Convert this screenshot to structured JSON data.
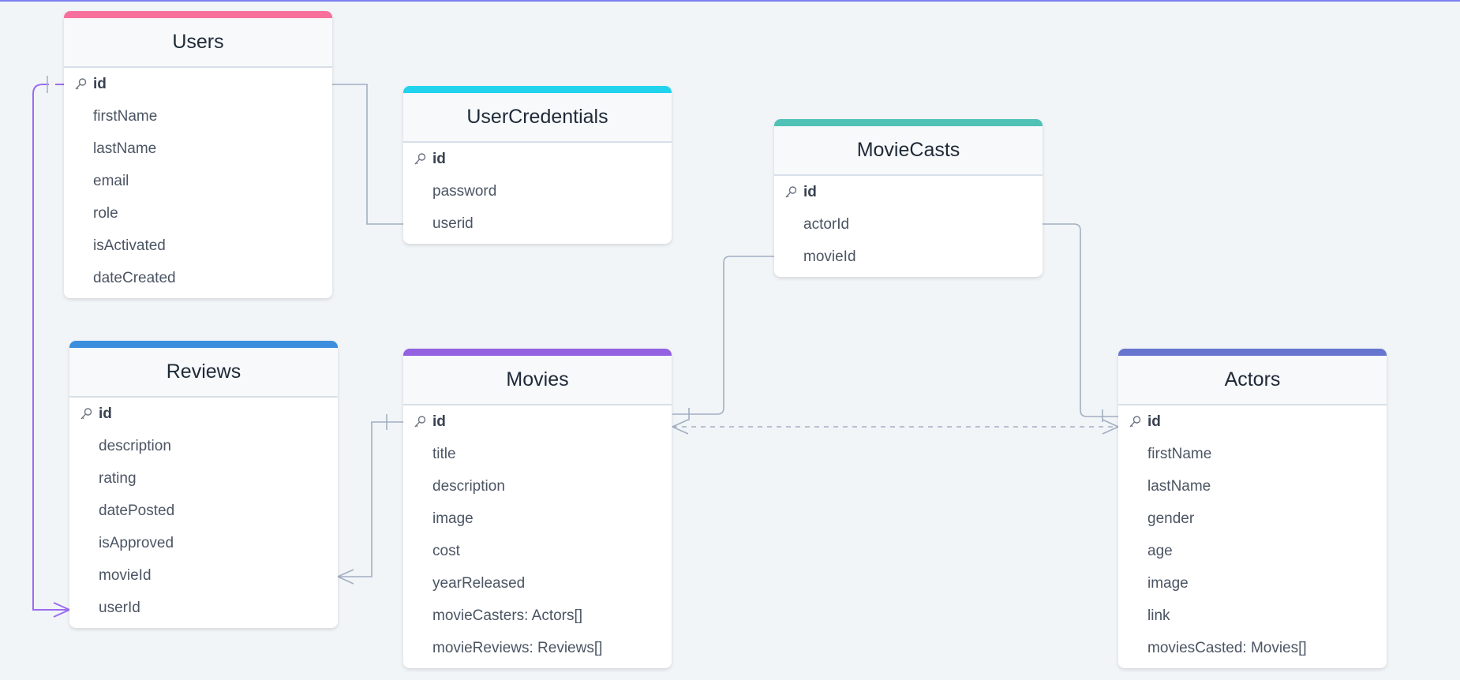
{
  "tables": [
    {
      "name": "Users",
      "color": "#f7709b",
      "fields": [
        "id",
        "firstName",
        "lastName",
        "email",
        "role",
        "isActivated",
        "dateCreated"
      ]
    },
    {
      "name": "UserCredentials",
      "color": "#22d3ee",
      "fields": [
        "id",
        "password",
        "userid"
      ]
    },
    {
      "name": "MovieCasts",
      "color": "#4fc1b5",
      "fields": [
        "id",
        "actorId",
        "movieId"
      ]
    },
    {
      "name": "Reviews",
      "color": "#3b8fdd",
      "fields": [
        "id",
        "description",
        "rating",
        "datePosted",
        "isApproved",
        "movieId",
        "userId"
      ]
    },
    {
      "name": "Movies",
      "color": "#9461e0",
      "fields": [
        "id",
        "title",
        "description",
        "image",
        "cost",
        "yearReleased",
        "movieCasters: Actors[]",
        "movieReviews: Reviews[]"
      ]
    },
    {
      "name": "Actors",
      "color": "#6676cf",
      "fields": [
        "id",
        "firstName",
        "lastName",
        "gender",
        "age",
        "image",
        "link",
        "moviesCasted: Movies[]"
      ]
    }
  ],
  "relationships": [
    {
      "from": "Users.id",
      "to": "UserCredentials.userid",
      "type": "one-to-one"
    },
    {
      "from": "Users.id",
      "to": "Reviews.userId",
      "type": "one-to-many",
      "highlighted": true
    },
    {
      "from": "Movies.id",
      "to": "Reviews.movieId",
      "type": "one-to-many"
    },
    {
      "from": "Movies.id",
      "to": "MovieCasts.movieId",
      "type": "one-to-one"
    },
    {
      "from": "Actors.id",
      "to": "MovieCasts.actorId",
      "type": "one-to-one"
    },
    {
      "from": "Movies.id",
      "to": "Actors.id",
      "type": "many-to-many",
      "dashed": true
    }
  ],
  "colors": {
    "link": "#a3afc2",
    "highlight": "#9b6cf0",
    "background": "#f1f5f8"
  },
  "icons": {
    "primary_key": "key-icon"
  }
}
